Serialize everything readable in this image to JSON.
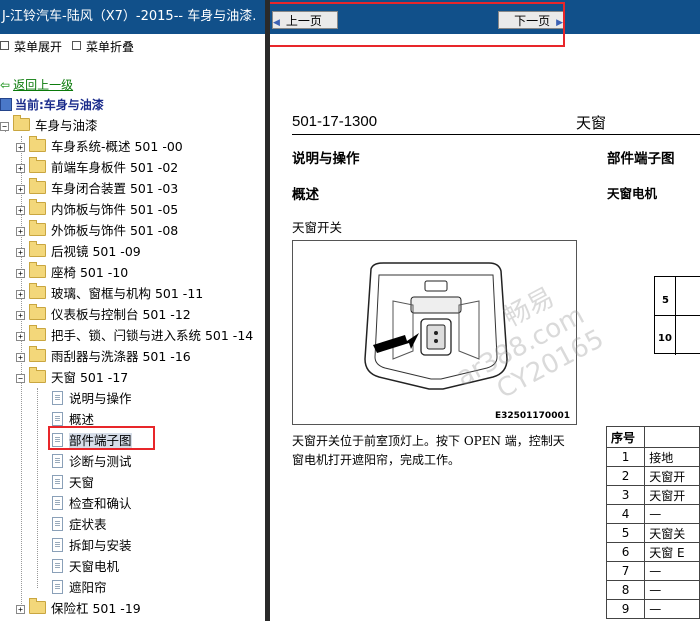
{
  "left_pane": {
    "title": "J-江铃汽车-陆风（X7）-2015-- 车身与油漆.",
    "expand_all": "菜单展开",
    "collapse_all": "菜单折叠",
    "back": "返回上一级",
    "current": "当前:车身与油漆",
    "root": "车身与油漆",
    "sections": [
      {
        "label": "车身系统-概述 501 -00"
      },
      {
        "label": "前端车身板件 501 -02"
      },
      {
        "label": "车身闭合装置 501 -03"
      },
      {
        "label": "内饰板与饰件 501 -05"
      },
      {
        "label": "外饰板与饰件 501 -08"
      },
      {
        "label": "后视镜 501 -09"
      },
      {
        "label": "座椅 501 -10"
      },
      {
        "label": "玻璃、窗框与机构 501 -11"
      },
      {
        "label": "仪表板与控制台 501 -12"
      },
      {
        "label": "把手、锁、闩锁与进入系统 501 -14"
      },
      {
        "label": "雨刮器与洗涤器 501 -16"
      },
      {
        "label": "天窗 501 -17"
      },
      {
        "label": "保险杠 501 -19"
      }
    ],
    "sunroof_children": [
      {
        "label": "说明与操作"
      },
      {
        "label": "概述"
      },
      {
        "label": "部件端子图"
      },
      {
        "label": "诊断与测试"
      },
      {
        "label": "天窗"
      },
      {
        "label": "检查和确认"
      },
      {
        "label": "症状表"
      },
      {
        "label": "拆卸与安装"
      },
      {
        "label": "天窗电机"
      },
      {
        "label": "遮阳帘"
      }
    ]
  },
  "nav": {
    "prev": "上一页",
    "next": "下一页"
  },
  "document": {
    "code": "501-17-1300",
    "chapter": "天窗",
    "section_left": "说明与操作",
    "section_right": "部件端子图",
    "overview": "概述",
    "right_sub": "天窗电机",
    "figure_title": "天窗开关",
    "figure_caption": "E32501170001",
    "description_line1": "天窗开关位于前室顶灯上。按下 OPEN 端，控制天",
    "description_line2": "窗电机打开遮阳帘，完成工作。",
    "connector_pins": [
      "5",
      "10"
    ],
    "table_header": "序号",
    "table_rows": [
      {
        "no": "1",
        "desc": "接地"
      },
      {
        "no": "2",
        "desc": "天窗开"
      },
      {
        "no": "3",
        "desc": "天窗开"
      },
      {
        "no": "4",
        "desc": "—"
      },
      {
        "no": "5",
        "desc": "天窗关"
      },
      {
        "no": "6",
        "desc": "天窗 E"
      },
      {
        "no": "7",
        "desc": "—"
      },
      {
        "no": "8",
        "desc": "—"
      },
      {
        "no": "9",
        "desc": "—"
      }
    ]
  },
  "watermark": {
    "line1": "畅易",
    "line2": "ar388.com",
    "line3": "CY20165"
  },
  "colors": {
    "title_bar": "#11508a",
    "highlight_box": "#e8262a",
    "back_link": "#0a7a0a",
    "current_text": "#1b2c8c"
  }
}
